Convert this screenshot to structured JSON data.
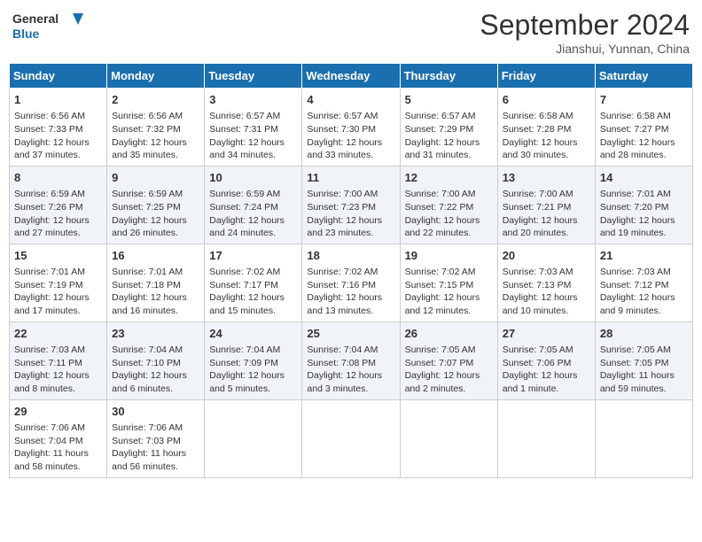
{
  "header": {
    "logo_line1": "General",
    "logo_line2": "Blue",
    "month": "September 2024",
    "location": "Jianshui, Yunnan, China"
  },
  "days_of_week": [
    "Sunday",
    "Monday",
    "Tuesday",
    "Wednesday",
    "Thursday",
    "Friday",
    "Saturday"
  ],
  "weeks": [
    [
      {
        "day": 1,
        "sunrise": "6:56 AM",
        "sunset": "7:33 PM",
        "daylight": "12 hours and 37 minutes."
      },
      {
        "day": 2,
        "sunrise": "6:56 AM",
        "sunset": "7:32 PM",
        "daylight": "12 hours and 35 minutes."
      },
      {
        "day": 3,
        "sunrise": "6:57 AM",
        "sunset": "7:31 PM",
        "daylight": "12 hours and 34 minutes."
      },
      {
        "day": 4,
        "sunrise": "6:57 AM",
        "sunset": "7:30 PM",
        "daylight": "12 hours and 33 minutes."
      },
      {
        "day": 5,
        "sunrise": "6:57 AM",
        "sunset": "7:29 PM",
        "daylight": "12 hours and 31 minutes."
      },
      {
        "day": 6,
        "sunrise": "6:58 AM",
        "sunset": "7:28 PM",
        "daylight": "12 hours and 30 minutes."
      },
      {
        "day": 7,
        "sunrise": "6:58 AM",
        "sunset": "7:27 PM",
        "daylight": "12 hours and 28 minutes."
      }
    ],
    [
      {
        "day": 8,
        "sunrise": "6:59 AM",
        "sunset": "7:26 PM",
        "daylight": "12 hours and 27 minutes."
      },
      {
        "day": 9,
        "sunrise": "6:59 AM",
        "sunset": "7:25 PM",
        "daylight": "12 hours and 26 minutes."
      },
      {
        "day": 10,
        "sunrise": "6:59 AM",
        "sunset": "7:24 PM",
        "daylight": "12 hours and 24 minutes."
      },
      {
        "day": 11,
        "sunrise": "7:00 AM",
        "sunset": "7:23 PM",
        "daylight": "12 hours and 23 minutes."
      },
      {
        "day": 12,
        "sunrise": "7:00 AM",
        "sunset": "7:22 PM",
        "daylight": "12 hours and 22 minutes."
      },
      {
        "day": 13,
        "sunrise": "7:00 AM",
        "sunset": "7:21 PM",
        "daylight": "12 hours and 20 minutes."
      },
      {
        "day": 14,
        "sunrise": "7:01 AM",
        "sunset": "7:20 PM",
        "daylight": "12 hours and 19 minutes."
      }
    ],
    [
      {
        "day": 15,
        "sunrise": "7:01 AM",
        "sunset": "7:19 PM",
        "daylight": "12 hours and 17 minutes."
      },
      {
        "day": 16,
        "sunrise": "7:01 AM",
        "sunset": "7:18 PM",
        "daylight": "12 hours and 16 minutes."
      },
      {
        "day": 17,
        "sunrise": "7:02 AM",
        "sunset": "7:17 PM",
        "daylight": "12 hours and 15 minutes."
      },
      {
        "day": 18,
        "sunrise": "7:02 AM",
        "sunset": "7:16 PM",
        "daylight": "12 hours and 13 minutes."
      },
      {
        "day": 19,
        "sunrise": "7:02 AM",
        "sunset": "7:15 PM",
        "daylight": "12 hours and 12 minutes."
      },
      {
        "day": 20,
        "sunrise": "7:03 AM",
        "sunset": "7:13 PM",
        "daylight": "12 hours and 10 minutes."
      },
      {
        "day": 21,
        "sunrise": "7:03 AM",
        "sunset": "7:12 PM",
        "daylight": "12 hours and 9 minutes."
      }
    ],
    [
      {
        "day": 22,
        "sunrise": "7:03 AM",
        "sunset": "7:11 PM",
        "daylight": "12 hours and 8 minutes."
      },
      {
        "day": 23,
        "sunrise": "7:04 AM",
        "sunset": "7:10 PM",
        "daylight": "12 hours and 6 minutes."
      },
      {
        "day": 24,
        "sunrise": "7:04 AM",
        "sunset": "7:09 PM",
        "daylight": "12 hours and 5 minutes."
      },
      {
        "day": 25,
        "sunrise": "7:04 AM",
        "sunset": "7:08 PM",
        "daylight": "12 hours and 3 minutes."
      },
      {
        "day": 26,
        "sunrise": "7:05 AM",
        "sunset": "7:07 PM",
        "daylight": "12 hours and 2 minutes."
      },
      {
        "day": 27,
        "sunrise": "7:05 AM",
        "sunset": "7:06 PM",
        "daylight": "12 hours and 1 minute."
      },
      {
        "day": 28,
        "sunrise": "7:05 AM",
        "sunset": "7:05 PM",
        "daylight": "11 hours and 59 minutes."
      }
    ],
    [
      {
        "day": 29,
        "sunrise": "7:06 AM",
        "sunset": "7:04 PM",
        "daylight": "11 hours and 58 minutes."
      },
      {
        "day": 30,
        "sunrise": "7:06 AM",
        "sunset": "7:03 PM",
        "daylight": "11 hours and 56 minutes."
      },
      null,
      null,
      null,
      null,
      null
    ]
  ]
}
